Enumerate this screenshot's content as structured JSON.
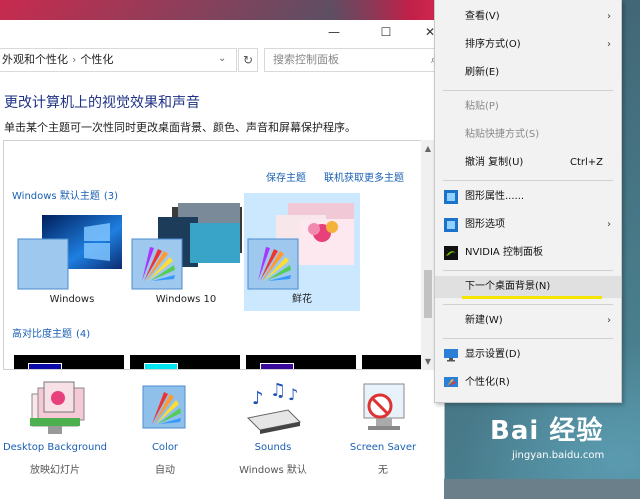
{
  "window": {
    "title_buttons": {
      "minimize": "—",
      "maximize": "☐",
      "close": "✕"
    },
    "breadcrumb": [
      "外观和个性化",
      "个性化"
    ],
    "search_placeholder": "搜索控制面板",
    "heading": "更改计算机上的视觉效果和声音",
    "subheading": "单击某个主题可一次性同时更改桌面背景、颜色、声音和屏幕保护程序。",
    "links": {
      "save_theme": "保存主题",
      "online_themes": "联机获取更多主题"
    },
    "groups": [
      {
        "label": "Windows 默认主题",
        "count": "(3)"
      },
      {
        "label": "高对比度主题",
        "count": "(4)"
      }
    ],
    "themes": [
      {
        "name": "Windows",
        "selected": false
      },
      {
        "name": "Windows 10",
        "selected": false
      },
      {
        "name": "鲜花",
        "selected": true
      }
    ],
    "bottom": [
      {
        "label": "Desktop Background",
        "value": "放映幻灯片",
        "icon": "desktop-background-icon"
      },
      {
        "label": "Color",
        "value": "自动",
        "icon": "color-palette-icon"
      },
      {
        "label": "Sounds",
        "value": "Windows 默认",
        "icon": "sounds-icon"
      },
      {
        "label": "Screen Saver",
        "value": "无",
        "icon": "screen-saver-icon"
      }
    ]
  },
  "context_menu": {
    "items": [
      {
        "label": "查看(V)",
        "submenu": true
      },
      {
        "label": "排序方式(O)",
        "submenu": true
      },
      {
        "label": "刷新(E)"
      },
      {
        "label": "粘贴(P)",
        "disabled": true
      },
      {
        "label": "粘贴快捷方式(S)",
        "disabled": true
      },
      {
        "label": "撤消 复制(U)",
        "shortcut": "Ctrl+Z"
      },
      {
        "label": "图形属性......",
        "icon": "intel-graphics-icon"
      },
      {
        "label": "图形选项",
        "icon": "intel-graphics-icon",
        "submenu": true
      },
      {
        "label": "NVIDIA 控制面板",
        "icon": "nvidia-icon"
      },
      {
        "label": "下一个桌面背景(N)",
        "highlighted": true
      },
      {
        "label": "新建(W)",
        "submenu": true
      },
      {
        "label": "显示设置(D)",
        "icon": "display-settings-icon"
      },
      {
        "label": "个性化(R)",
        "icon": "personalize-icon"
      }
    ],
    "highlight_color": "#f5e600"
  },
  "watermark": {
    "brand": "Bai 经验",
    "url": "jingyan.baidu.com"
  }
}
